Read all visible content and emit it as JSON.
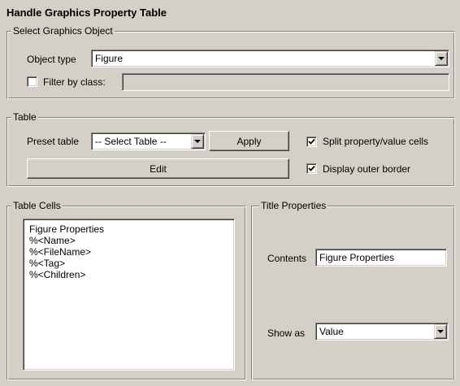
{
  "title": "Handle Graphics Property Table",
  "select_group": {
    "legend": "Select Graphics Object",
    "object_type_label": "Object type",
    "object_type_value": "Figure",
    "filter_label": "Filter by class:",
    "filter_checked": false,
    "filter_value": ""
  },
  "table_group": {
    "legend": "Table",
    "preset_label": "Preset table",
    "preset_value": "-- Select Table --",
    "apply_label": "Apply",
    "edit_label": "Edit",
    "split_label": "Split property/value cells",
    "split_checked": true,
    "border_label": "Display outer border",
    "border_checked": true
  },
  "cells_group": {
    "legend": "Table Cells",
    "items": [
      "Figure Properties",
      "%<Name>",
      "%<FileName>",
      "%<Tag>",
      "%<Children>"
    ]
  },
  "title_props_group": {
    "legend": "Title Properties",
    "contents_label": "Contents",
    "contents_value": "Figure Properties",
    "show_as_label": "Show as",
    "show_as_value": "Value"
  },
  "icons": {
    "checkmark": "checkmark-icon",
    "dropdown": "chevron-down-icon"
  }
}
